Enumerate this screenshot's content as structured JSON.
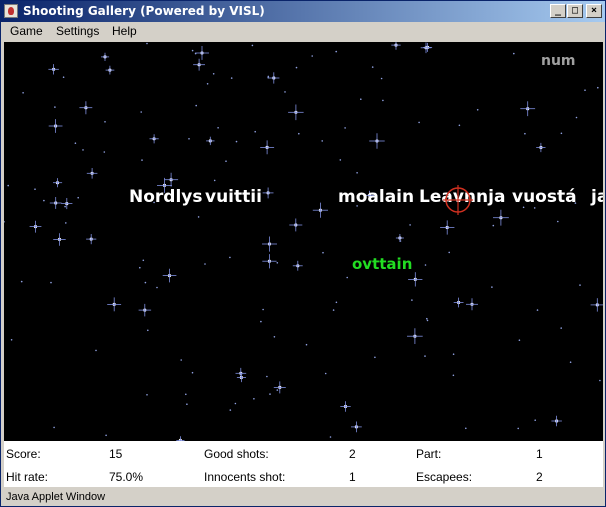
{
  "window": {
    "title": "Shooting Gallery (Powered by VISL)"
  },
  "titlebar": {
    "minimize_glyph": "_",
    "maximize_glyph": "□",
    "close_glyph": "×"
  },
  "menu": {
    "items": [
      "Game",
      "Settings",
      "Help"
    ]
  },
  "game": {
    "words": [
      {
        "text": "Nordlys",
        "color": "#ffffff"
      },
      {
        "text": "vuittii",
        "color": "#ffffff"
      },
      {
        "text": "moalain",
        "color": "#ffffff"
      },
      {
        "text": "Leavnnja",
        "color": "#ffffff"
      },
      {
        "text": "vuostá",
        "color": "#ffffff"
      },
      {
        "text": "ja",
        "color": "#ffffff"
      },
      {
        "text": "ovttain",
        "color": "#22dd22"
      },
      {
        "text": "num",
        "color": "#a0a0a0"
      }
    ],
    "crosshair_color": "#d03020"
  },
  "stats": {
    "score_label": "Score:",
    "score_value": "15",
    "hitrate_label": "Hit rate:",
    "hitrate_value": "75.0%",
    "good_label": "Good shots:",
    "good_value": "2",
    "innocents_label": "Innocents shot:",
    "innocents_value": "1",
    "part_label": "Part:",
    "part_value": "1",
    "escapees_label": "Escapees:",
    "escapees_value": "2"
  },
  "footer": {
    "text": "Java Applet Window"
  }
}
